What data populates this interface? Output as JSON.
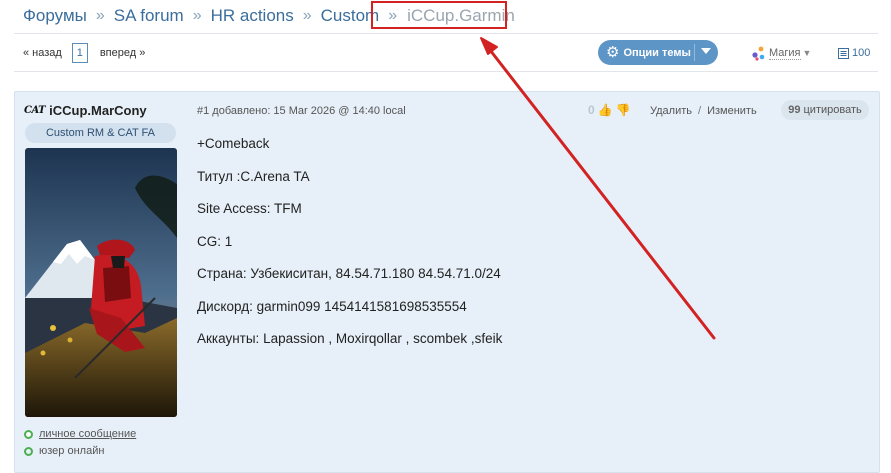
{
  "breadcrumb": {
    "items": [
      {
        "label": "Форумы"
      },
      {
        "label": "SA forum"
      },
      {
        "label": "HR actions"
      },
      {
        "label": "Custom"
      }
    ],
    "separator": "»",
    "current": "iCCup.Garmin"
  },
  "toolbar": {
    "prev_label": "« назад",
    "page": "1",
    "next_label": "вперед »",
    "options_label": "Опции темы",
    "style_label": "Магия",
    "count": "100"
  },
  "post": {
    "author": {
      "name": "iCCup.MarCony",
      "logo_text": "CAT",
      "title": "Custom RM & CAT FA",
      "pm_link": "личное сообщение",
      "online_text": "юзер онлайн"
    },
    "meta": "#1 добавлено: 15 Mar 2026 @ 14:40 local",
    "vote_count": "0",
    "actions": {
      "delete_label": "Удалить",
      "separator": "/",
      "edit_label": "Изменить",
      "quote_mark": "99",
      "quote_label": "цитировать"
    },
    "body": [
      "+Comeback",
      "Титул :C.Arena TA",
      "Site Access: TFM",
      "CG: 1",
      "Страна: Узбекиситан, 84.54.71.180 84.54.71.0/24",
      "Дискорд: garmin099 1454141581698535554",
      "Аккаунты: Lapassion , Moxirqollar , scombek ,sfeik"
    ]
  },
  "colors": {
    "link": "#3b6e9c",
    "button": "#5d96c6",
    "post_bg": "#e7f0f8",
    "annotation": "#d32222",
    "online_dot": "#4caf50"
  },
  "icons": [
    "gear-icon",
    "caret-down-icon",
    "magic-style-icon",
    "list-count-icon",
    "thumb-up-icon",
    "thumb-down-icon",
    "quote-icon",
    "message-dot-icon",
    "online-dot-icon",
    "annotation-arrow"
  ]
}
